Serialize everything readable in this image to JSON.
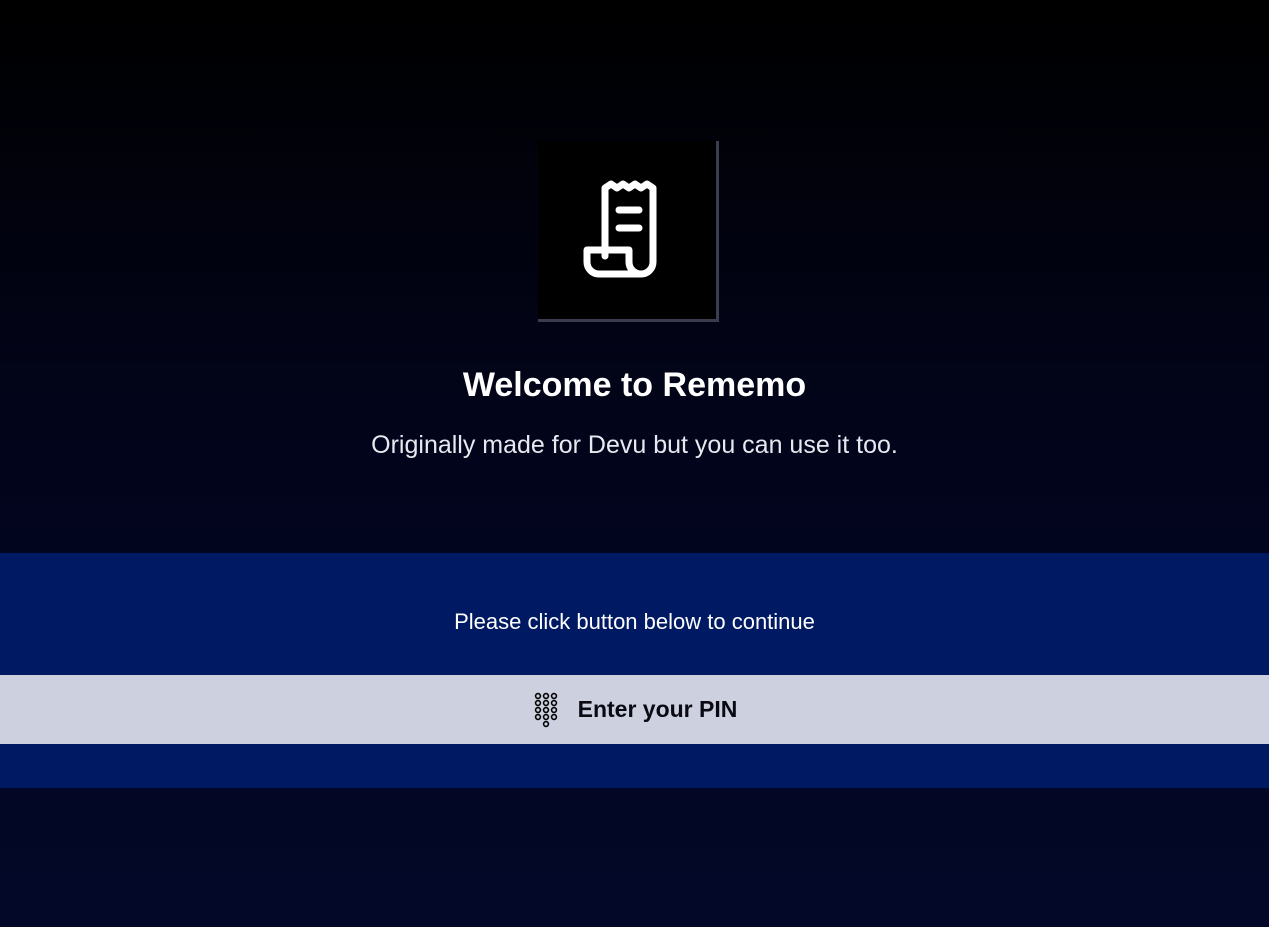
{
  "logo": {
    "icon": "receipt-icon"
  },
  "welcome": {
    "title": "Welcome to Rememo",
    "subtitle": "Originally made for Devu but you can use it too."
  },
  "prompt": {
    "instruction": "Please click button below to continue",
    "button_label": "Enter your PIN",
    "button_icon": "keypad-icon"
  },
  "colors": {
    "band": "#001963",
    "button_bg": "#cdd0de",
    "background_top": "#000000",
    "background_bottom": "#030829"
  }
}
